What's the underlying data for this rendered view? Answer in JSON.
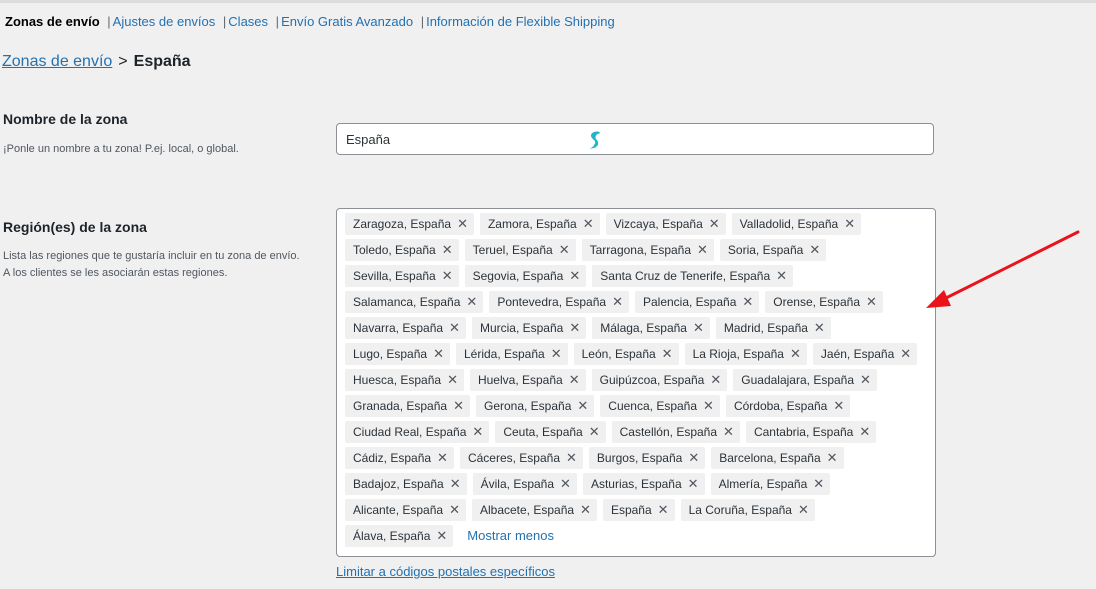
{
  "subnav": {
    "current": "Zonas de envío",
    "links": [
      "Ajustes de envíos",
      "Clases",
      "Envío Gratis Avanzado",
      "Información de Flexible Shipping"
    ]
  },
  "breadcrumb": {
    "parent": "Zonas de envío",
    "separator": ">",
    "current": "España"
  },
  "zone_name": {
    "label": "Nombre de la zona",
    "description": "¡Ponle un nombre a tu zona! P.ej. local, o global.",
    "value": "España"
  },
  "regions": {
    "label": "Región(es) de la zona",
    "description": "Lista las regiones que te gustaría incluir en tu zona de envío. A los clientes se les asociarán estas regiones.",
    "items": [
      "Zaragoza, España",
      "Zamora, España",
      "Vizcaya, España",
      "Valladolid, España",
      "Toledo, España",
      "Teruel, España",
      "Tarragona, España",
      "Soria, España",
      "Sevilla, España",
      "Segovia, España",
      "Santa Cruz de Tenerife, España",
      "Salamanca, España",
      "Pontevedra, España",
      "Palencia, España",
      "Orense, España",
      "Navarra, España",
      "Murcia, España",
      "Málaga, España",
      "Madrid, España",
      "Lugo, España",
      "Lérida, España",
      "León, España",
      "La Rioja, España",
      "Jaén, España",
      "Huesca, España",
      "Huelva, España",
      "Guipúzcoa, España",
      "Guadalajara, España",
      "Granada, España",
      "Gerona, España",
      "Cuenca, España",
      "Córdoba, España",
      "Ciudad Real, España",
      "Ceuta, España",
      "Castellón, España",
      "Cantabria, España",
      "Cádiz, España",
      "Cáceres, España",
      "Burgos, España",
      "Barcelona, España",
      "Badajoz, España",
      "Ávila, España",
      "Asturias, España",
      "Almería, España",
      "Alicante, España",
      "Albacete, España",
      "España",
      "La Coruña, España",
      "Álava, España"
    ],
    "remove_glyph": "✕",
    "show_less": "Mostrar menos"
  },
  "limit_link": "Limitar a códigos postales específicos",
  "icons": {
    "extension": "surfshark-icon",
    "annotation": "red-arrow-icon"
  },
  "colors": {
    "link": "#2271b1",
    "arrow": "#e8141a",
    "extension": "#1eb6c9"
  }
}
